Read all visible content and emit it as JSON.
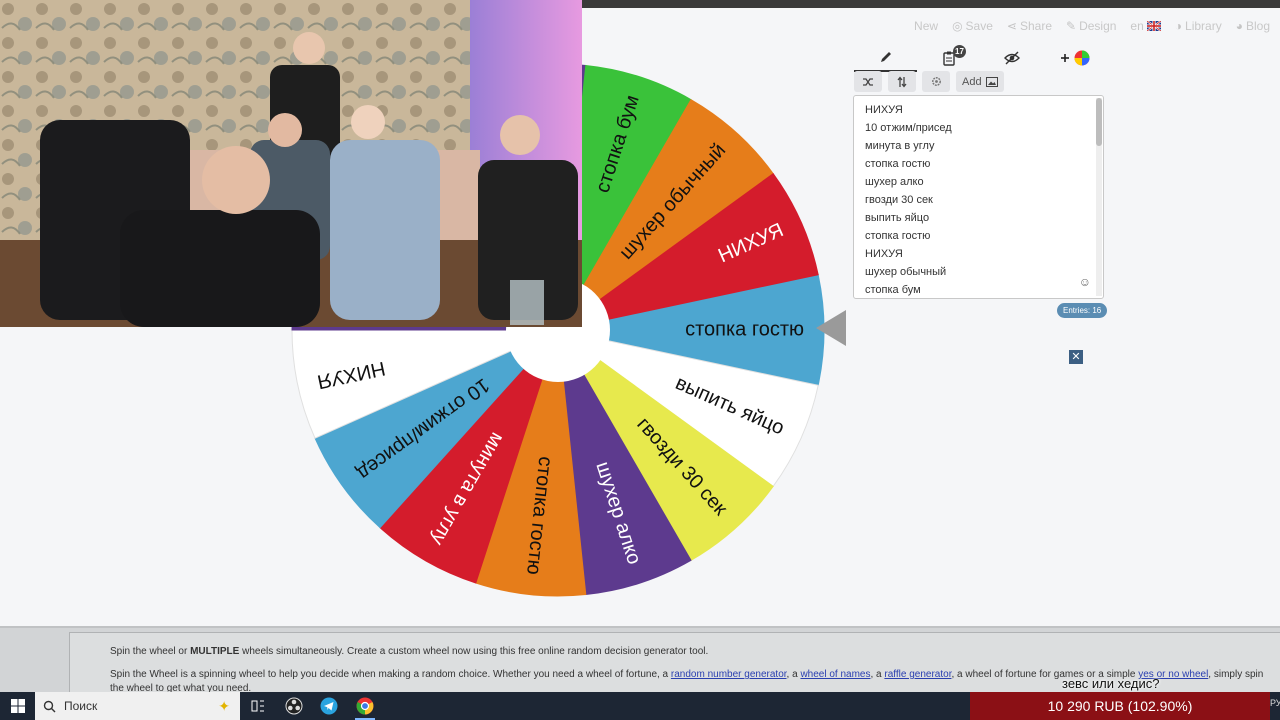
{
  "nav": {
    "items": [
      {
        "label": "New",
        "icon": ""
      },
      {
        "label": "Save",
        "icon": "◎"
      },
      {
        "label": "Share",
        "icon": "⋖"
      },
      {
        "label": "Design",
        "icon": "✎"
      },
      {
        "label": "en",
        "icon": "flag-uk-icon"
      },
      {
        "label": "Library",
        "icon": "◑"
      },
      {
        "label": "Blog",
        "icon": "◕"
      }
    ]
  },
  "tabs": {
    "clipboard_badge": "17"
  },
  "toolbar": {
    "add_label": "Add"
  },
  "entries": [
    "НИХУЯ",
    "10 отжим/присед",
    "минута в углу",
    "стопка гостю",
    "шухер алко",
    "гвозди 30 сек",
    "выпить яйцо",
    "стопка гостю",
    "НИХУЯ",
    "шухер обычный",
    "стопка бум"
  ],
  "entries_count": "Entries: 16",
  "wheel": {
    "segments": [
      {
        "label": "стопка гостю",
        "color": "#4da6d0",
        "text_color": "#111111"
      },
      {
        "label": "выпить яйцо",
        "color": "#ffffff",
        "text_color": "#111111"
      },
      {
        "label": "гвозди 30 сек",
        "color": "#e7e94d",
        "text_color": "#111111"
      },
      {
        "label": "шухер алко",
        "color": "#5d3a8e",
        "text_color": "#ffffff"
      },
      {
        "label": "стопка гостю",
        "color": "#e67d1a",
        "text_color": "#111111"
      },
      {
        "label": "минута в углу",
        "color": "#d41c2c",
        "text_color": "#ffffff"
      },
      {
        "label": "10 отжим/присед",
        "color": "#4da6d0",
        "text_color": "#111111"
      },
      {
        "label": "НИХУЯ",
        "color": "#ffffff",
        "text_color": "#111111"
      },
      {
        "label": "",
        "color": "#5d3a8e",
        "text_color": "#ffffff"
      },
      {
        "label": "",
        "color": "#5d3a8e",
        "text_color": "#ffffff"
      },
      {
        "label": "",
        "color": "#5d3a8e",
        "text_color": "#ffffff"
      },
      {
        "label": "",
        "color": "#5d3a8e",
        "text_color": "#ffffff"
      },
      {
        "label": "стопка бум",
        "color": "#3ac23a",
        "text_color": "#111111"
      },
      {
        "label": "шухер обычный",
        "color": "#e67d1a",
        "text_color": "#111111"
      },
      {
        "label": "НИХУЯ",
        "color": "#d41c2c",
        "text_color": "#ffffff"
      }
    ]
  },
  "bottom": {
    "line1_pre": "Spin the wheel or ",
    "line1_bold": "MULTIPLE",
    "line1_post": " wheels simultaneously. Create a custom wheel now using this free online random decision generator tool.",
    "line2_a": "Spin the Wheel is a spinning wheel to help you decide when making a random choice. Whether you need a wheel of fortune, a ",
    "link1": "random number generator",
    "line2_b": ", a ",
    "link2": "wheel of names",
    "line2_c": ", a ",
    "link3": "raffle generator",
    "line2_d": ", a wheel of fortune for games or a simple ",
    "link4": "yes or no wheel",
    "line2_e": ", simply spin",
    "line3": "the wheel to get what you need."
  },
  "taskbar": {
    "search_placeholder": "Поиск"
  },
  "overlay": {
    "donation": "10 290 RUB (102.90%)",
    "ticker": "зевс или хедис?",
    "lang": "РУ"
  },
  "colors": {
    "webcam_wall": "#c9b79a",
    "panel_accent": "#5b8db3"
  }
}
